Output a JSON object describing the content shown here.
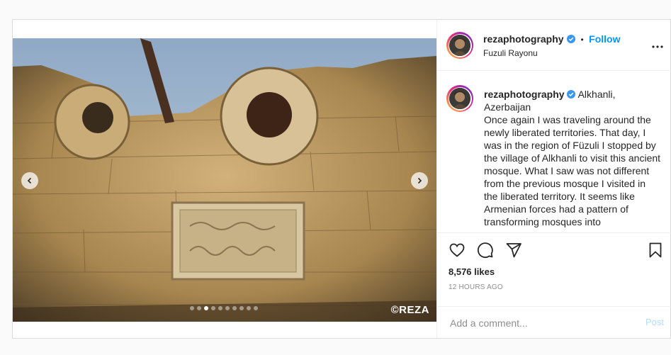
{
  "post": {
    "username": "rezaphotography",
    "location": "Fuzuli Rayonu",
    "follow_label": "Follow",
    "separator": "•",
    "watermark": "©REZA",
    "caption": {
      "username": "rezaphotography",
      "location_inline": "Alkhanli, Azerbaijan",
      "text": "Once again I was traveling around the newly liberated territories. That day, I was in the region of Füzuli I stopped by the village of Alkhanli to visit this ancient mosque. What I saw was not different from the previous mosque I visited in the liberated territory. It seems like Armenian forces had a pattern of transforming mosques into"
    },
    "likes": "8,576 likes",
    "timestamp": "12 HOURS AGO",
    "comment_placeholder": "Add a comment...",
    "post_button": "Post",
    "carousel": {
      "total": 10,
      "active": 3
    }
  },
  "icons": [
    "verified-badge-icon",
    "more-options-icon",
    "heart-icon",
    "comment-icon",
    "share-icon",
    "bookmark-icon",
    "chevron-left-icon",
    "chevron-right-icon"
  ],
  "colors": {
    "link_blue": "#0095f6",
    "post_disabled": "#b2dffc",
    "muted": "#8e8e8e"
  }
}
